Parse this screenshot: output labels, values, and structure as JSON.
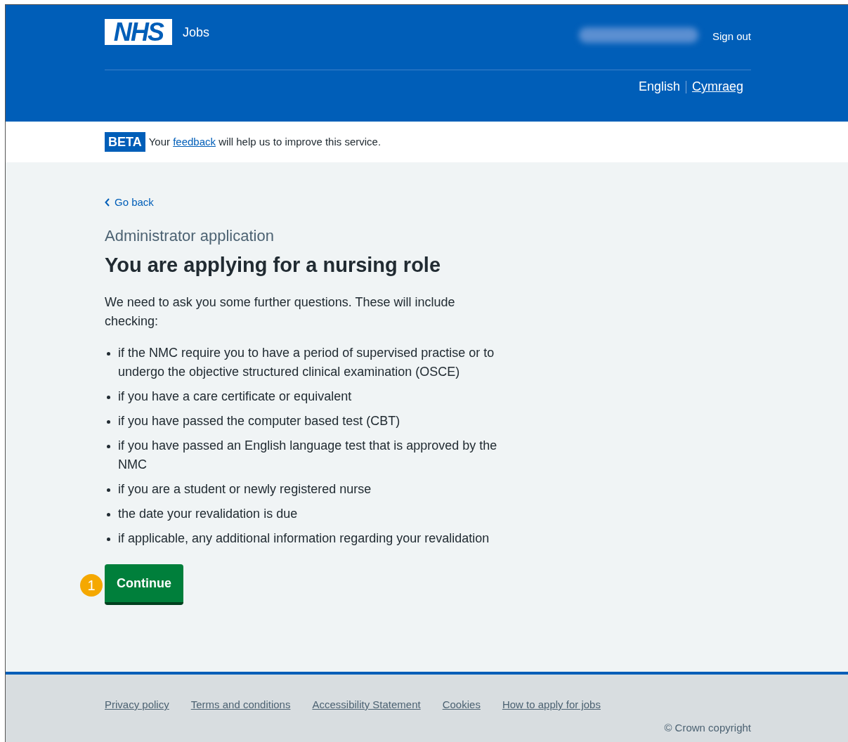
{
  "header": {
    "logo_text": "NHS",
    "service_name": "Jobs",
    "sign_out": "Sign out",
    "languages": [
      {
        "label": "English",
        "selected": true
      },
      {
        "label": "Cymraeg",
        "selected": false
      }
    ]
  },
  "beta_banner": {
    "tag": "BETA",
    "message_start": "Your",
    "link": "feedback",
    "message_end": "will help us to improve this service."
  },
  "back_link": "Go back",
  "caption": "Administrator application",
  "heading": "You are applying for a nursing role",
  "intro": "We need to ask you some further questions. These will include checking:",
  "items": [
    "if the NMC require you to have a period of supervised practise or to undergo the objective structured clinical examination (OSCE)",
    "if you have a care certificate or equivalent",
    "if you have passed the computer based test (CBT)",
    "if you have passed an English language test that is approved by the NMC",
    "if you are a student or newly registered nurse",
    "the date your revalidation is due",
    "if applicable, any additional information regarding your revalidation"
  ],
  "continue_button": {
    "label": "Continue",
    "marker": "1"
  },
  "footer": {
    "links": [
      "Privacy policy",
      "Terms and conditions",
      "Accessibility Statement",
      "Cookies",
      "How to apply for jobs"
    ],
    "copyright": "© Crown copyright"
  }
}
